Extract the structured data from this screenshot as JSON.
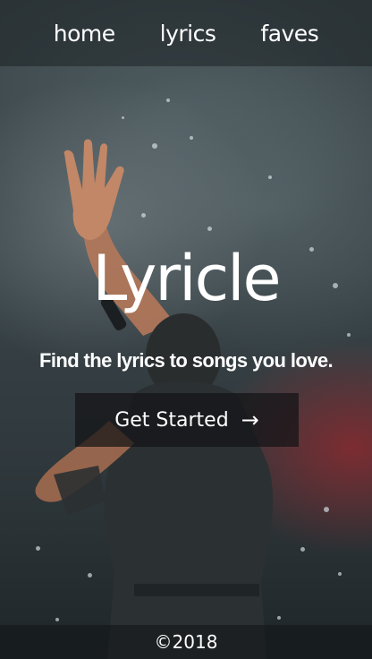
{
  "nav": {
    "items": [
      {
        "label": "home"
      },
      {
        "label": "lyrics"
      },
      {
        "label": "faves"
      }
    ]
  },
  "hero": {
    "title": "Lyricle",
    "tagline": "Find the lyrics to songs you love.",
    "cta_label": "Get Started",
    "cta_icon": "→"
  },
  "footer": {
    "text": "©2018"
  },
  "colors": {
    "text": "#ffffff",
    "cta_background": "#141416",
    "background": "#3a4549",
    "smoke_red": "#96282d"
  }
}
